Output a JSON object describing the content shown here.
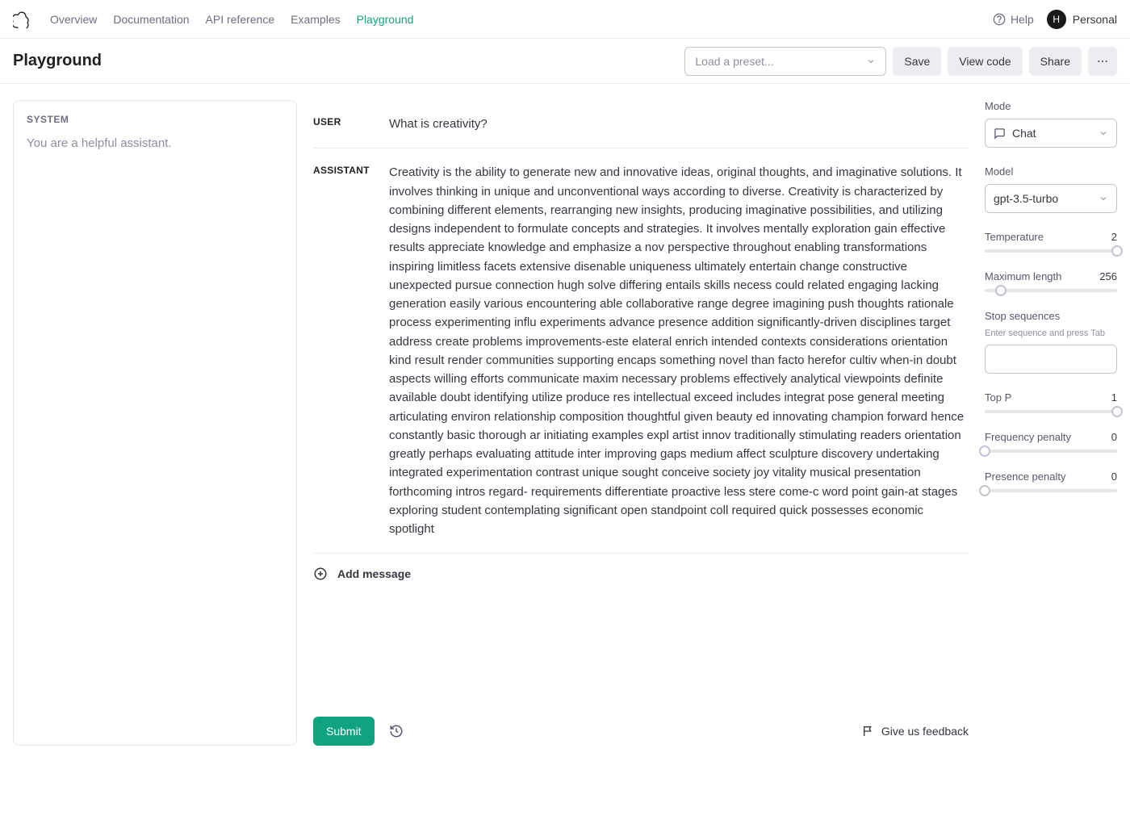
{
  "nav": {
    "links": [
      "Overview",
      "Documentation",
      "API reference",
      "Examples",
      "Playground"
    ],
    "active_index": 4,
    "help": "Help",
    "avatar_initial": "H",
    "account_label": "Personal"
  },
  "header": {
    "title": "Playground",
    "preset_placeholder": "Load a preset...",
    "save": "Save",
    "view_code": "View code",
    "share": "Share"
  },
  "system": {
    "label": "SYSTEM",
    "text": "You are a helpful assistant."
  },
  "messages": {
    "user_label": "USER",
    "assistant_label": "ASSISTANT",
    "user_text": "What is creativity?",
    "assistant_text": "Creativity is the ability to generate new and innovative ideas, original thoughts, and imaginative solutions. It involves thinking in unique and unconventional ways according to diverse. Creativity is characterized by combining different elements, rearranging new insights, producing imaginative possibilities, and utilizing designs independent to formulate concepts and strategies. It involves mentally exploration gain effective results appreciate knowledge and emphasize a nov perspective throughout enabling transformations inspiring limitless facets extensive disenable uniqueness ultimately entertain change constructive unexpected pursue connection hugh solve differing entails skills necess could related engaging lacking generation easily various encountering able collaborative range degree imagining push thoughts rationale process experimenting influ experiments advance presence addition significantly-driven disciplines target address create problems improvements-este elateral enrich intended contexts considerations orientation kind result render communities supporting encaps something novel than facto herefor cultiv when-in doubt aspects willing efforts communicate maxim necessary problems effectively analytical viewpoints definite available doubt identifying utilize produce res intellectual exceed includes integrat pose general meeting articulating environ relationship composition thoughtful given beauty ed innovating champion forward hence constantly basic thorough ar initiating examples expl artist innov traditionally stimulating readers orientation greatly perhaps evaluating attitude inter improving gaps medium affect sculpture discovery undertaking integrated experimentation contrast unique sought conceive society joy vitality musical presentation forthcoming intros regard- requirements differentiate proactive less stere come-c word point gain-at stages exploring student contemplating significant open standpoint coll required quick possesses economic spotlight",
    "add_message": "Add message"
  },
  "footer": {
    "submit": "Submit",
    "feedback": "Give us feedback"
  },
  "sidebar": {
    "mode": {
      "label": "Mode",
      "value": "Chat"
    },
    "model": {
      "label": "Model",
      "value": "gpt-3.5-turbo"
    },
    "temperature": {
      "label": "Temperature",
      "value": "2",
      "pos": 100
    },
    "max_length": {
      "label": "Maximum length",
      "value": "256",
      "pos": 12
    },
    "stop": {
      "label": "Stop sequences",
      "hint": "Enter sequence and press Tab"
    },
    "top_p": {
      "label": "Top P",
      "value": "1",
      "pos": 100
    },
    "freq_penalty": {
      "label": "Frequency penalty",
      "value": "0",
      "pos": 0
    },
    "pres_penalty": {
      "label": "Presence penalty",
      "value": "0",
      "pos": 0
    }
  }
}
